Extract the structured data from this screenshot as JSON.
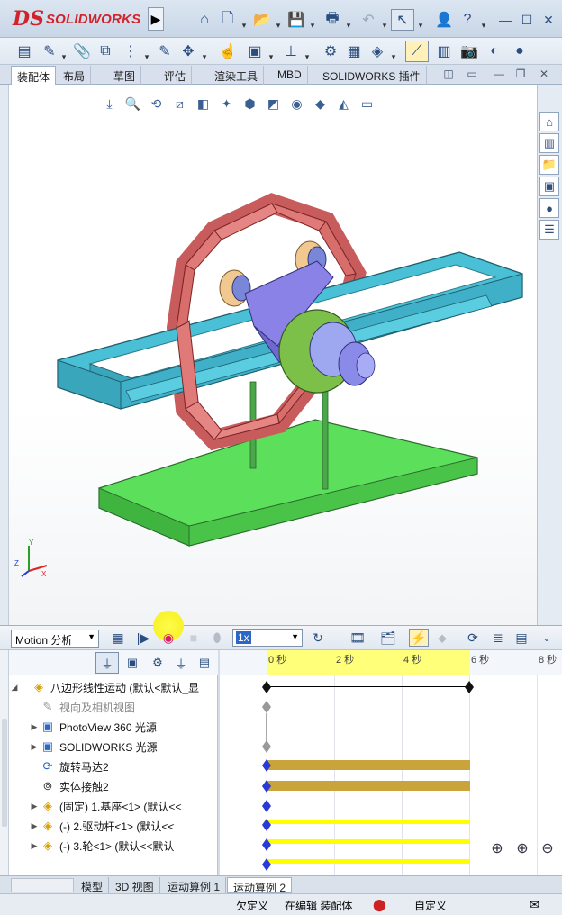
{
  "app": {
    "brand": "SOLIDWORKS",
    "logo_mark": "DS"
  },
  "cmd_tabs": [
    {
      "label": "装配体",
      "active": true
    },
    {
      "label": "布局"
    },
    {
      "label": "草图"
    },
    {
      "label": "评估"
    },
    {
      "label": "渲染工具"
    },
    {
      "label": "MBD"
    },
    {
      "label": "SOLIDWORKS 插件"
    }
  ],
  "motion": {
    "study_type": "Motion 分析",
    "playback_speed": "1x",
    "ruler": [
      "0 秒",
      "2 秒",
      "4 秒",
      "6 秒",
      "8 秒"
    ]
  },
  "tree": [
    {
      "label": "八边形线性运动  (默认<默认_显",
      "icon": "assembly-icon"
    },
    {
      "label": "视向及相机视图",
      "icon": "camera-icon",
      "dim": true
    },
    {
      "label": "PhotoView 360 光源",
      "icon": "light-icon"
    },
    {
      "label": "SOLIDWORKS 光源",
      "icon": "light-icon"
    },
    {
      "label": "旋转马达2",
      "icon": "motor-icon"
    },
    {
      "label": "实体接触2",
      "icon": "contact-icon"
    },
    {
      "label": "(固定) 1.基座<1> (默认<<",
      "icon": "part-icon"
    },
    {
      "label": "(-) 2.驱动杆<1> (默认<<",
      "icon": "part-icon"
    },
    {
      "label": "(-) 3.轮<1> (默认<<默认",
      "icon": "part-icon"
    }
  ],
  "bottom_tabs": [
    {
      "label": "模型"
    },
    {
      "label": "3D 视图"
    },
    {
      "label": "运动算例 1"
    },
    {
      "label": "运动算例 2",
      "active": true
    }
  ],
  "status": {
    "definition": "欠定义",
    "editing": "在编辑 装配体",
    "units": "自定义"
  },
  "colors": {
    "accent": "#2a67c8",
    "timeline_yellow": "#ffff7a",
    "track_gold": "#c8a43a",
    "track_yellow": "#ffff00",
    "record_highlight": "#f3ef1c"
  }
}
